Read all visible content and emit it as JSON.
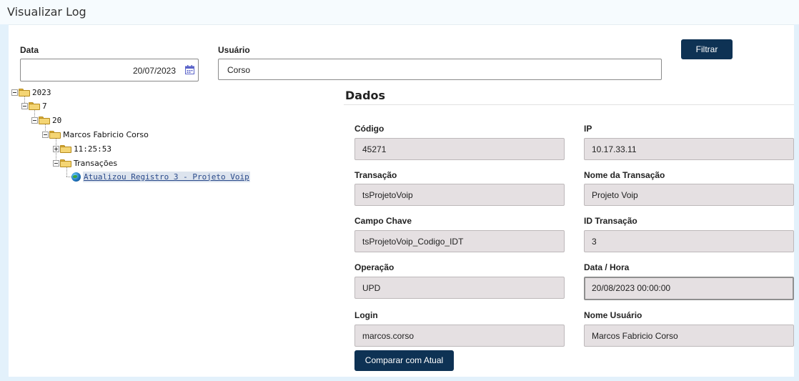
{
  "header": {
    "title": "Visualizar Log"
  },
  "filters": {
    "date_label": "Data",
    "date_value": "20/07/2023",
    "user_label": "Usuário",
    "user_value": "Corso",
    "filter_button": "Filtrar"
  },
  "tree": {
    "year": "2023",
    "month": "7",
    "day": "20",
    "user": "Marcos Fabricio Corso",
    "time": "11:25:53",
    "transactions": "Transações",
    "leaf": "Atualizou Registro 3 - Projeto Voip"
  },
  "details": {
    "title": "Dados",
    "fields": {
      "codigo": {
        "label": "Código",
        "value": "45271"
      },
      "ip": {
        "label": "IP",
        "value": "10.17.33.11"
      },
      "transacao": {
        "label": "Transação",
        "value": "tsProjetoVoip"
      },
      "nome_transacao": {
        "label": "Nome da Transação",
        "value": "Projeto Voip"
      },
      "campo_chave": {
        "label": "Campo Chave",
        "value": "tsProjetoVoip_Codigo_IDT"
      },
      "id_transacao": {
        "label": "ID Transação",
        "value": "3"
      },
      "operacao": {
        "label": "Operação",
        "value": "UPD"
      },
      "data_hora": {
        "label": "Data / Hora",
        "value": "20/08/2023 00:00:00"
      },
      "login": {
        "label": "Login",
        "value": "marcos.corso"
      },
      "nome_usuario": {
        "label": "Nome Usuário",
        "value": "Marcos Fabricio Corso"
      }
    },
    "compare_button": "Comparar com Atual"
  },
  "colors": {
    "primary_button": "#0e3254",
    "field_background": "#e5e0e2",
    "frame": "#e3f1fb"
  }
}
